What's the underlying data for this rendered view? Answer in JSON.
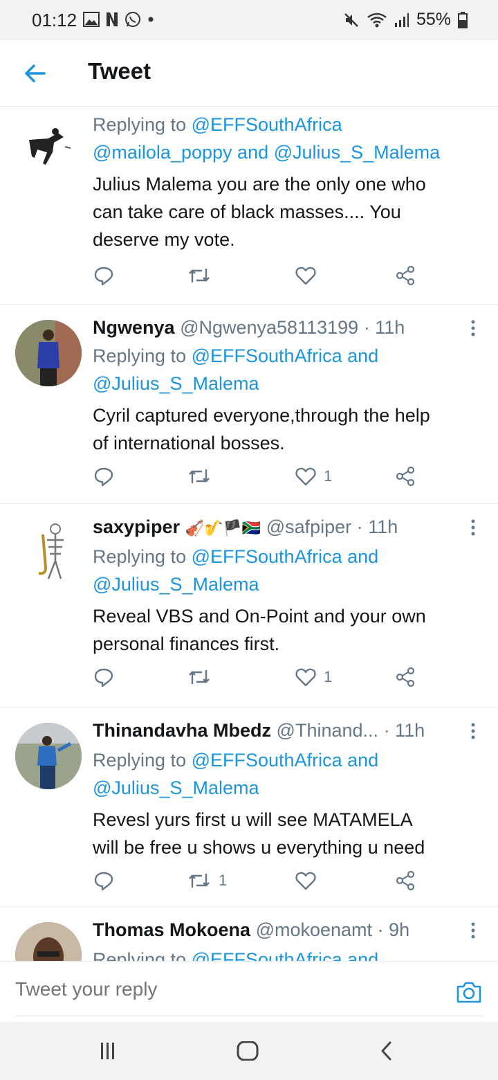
{
  "status_bar": {
    "time": "01:12",
    "battery": "55%",
    "left_icons": [
      "gallery-icon",
      "netflix-icon",
      "whatsapp-icon",
      "dot-icon"
    ],
    "right_icons": [
      "mute-icon",
      "wifi-icon",
      "signal-icon",
      "battery-icon"
    ]
  },
  "header": {
    "title": "Tweet",
    "back_icon": "arrow-left-icon"
  },
  "colors": {
    "accent": "#1b95e0",
    "muted": "#657786",
    "text": "#14171a",
    "divider": "#e6ecf0"
  },
  "tweets": [
    {
      "name": "",
      "handle": "",
      "time": "",
      "replying_prefix": "Replying to",
      "mentions_line1": "@EFFSouthAfrica",
      "mentions_line2_a": "@mailola_poppy",
      "mentions_line2_joiner": "and",
      "mentions_line2_b": "@Julius_S_Malema",
      "text_lines": [
        "Julius Malema you are the only one who",
        "can take care of black masses.... You",
        "deserve my vote."
      ],
      "reply_count": "",
      "retweet_count": "",
      "like_count": ""
    },
    {
      "name": "Ngwenya",
      "handle": "@Ngwenya58113199",
      "time": "· 11h",
      "replying_prefix": "Replying to",
      "mention_a": "@EFFSouthAfrica",
      "joiner": "and",
      "mention_b": "@Julius_S_Malema",
      "text_lines": [
        "Cyril captured everyone,through the help",
        "of international bosses."
      ],
      "reply_count": "",
      "retweet_count": "",
      "like_count": "1"
    },
    {
      "name": "saxypiper",
      "name_emoji": "🎻🎷🏴🇿🇦",
      "handle": "@safpiper",
      "time": "· 11h",
      "replying_prefix": "Replying to",
      "mention_a": "@EFFSouthAfrica",
      "joiner": "and",
      "mention_b": "@Julius_S_Malema",
      "text_lines": [
        "Reveal VBS and On-Point and your own",
        "personal finances first."
      ],
      "reply_count": "",
      "retweet_count": "",
      "like_count": "1"
    },
    {
      "name": "Thinandavha Mbedz",
      "handle": "@Thinand...",
      "time": "· 11h",
      "replying_prefix": "Replying to",
      "mention_a": "@EFFSouthAfrica",
      "joiner": "and",
      "mention_b": "@Julius_S_Malema",
      "text_lines": [
        "Revesl yurs first  u will see MATAMELA",
        "will be free u shows u everything u need"
      ],
      "reply_count": "",
      "retweet_count": "1",
      "like_count": ""
    },
    {
      "name": "Thomas Mokoena",
      "handle": "@mokoenamt",
      "time": "· 9h",
      "replying_prefix": "Replying to",
      "mention_a": "@EFFSouthAfrica",
      "joiner": "and"
    }
  ],
  "reply_bar": {
    "placeholder": "Tweet your reply",
    "camera_icon": "camera-icon"
  },
  "nav_bar": {
    "icons": [
      "recents-icon",
      "home-icon",
      "back-icon"
    ]
  }
}
